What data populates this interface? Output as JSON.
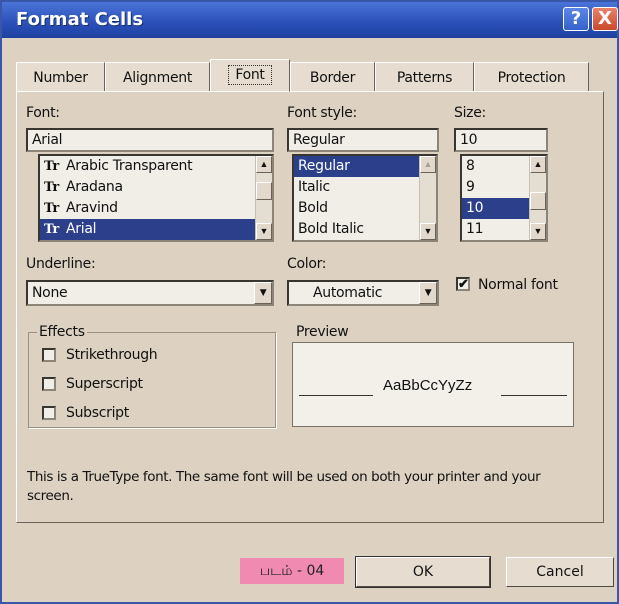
{
  "window": {
    "title": "Format Cells",
    "help_glyph": "?",
    "close_glyph": "X"
  },
  "tabs": [
    {
      "label": "Number"
    },
    {
      "label": "Alignment"
    },
    {
      "label": "Font",
      "active": true
    },
    {
      "label": "Border"
    },
    {
      "label": "Patterns"
    },
    {
      "label": "Protection"
    }
  ],
  "font": {
    "label": "Font:",
    "value": "Arial",
    "items": [
      "Arabic Transparent",
      "Aradana",
      "Aravind",
      "Arial"
    ],
    "selected": "Arial",
    "icon_glyph": "Tr"
  },
  "font_style": {
    "label": "Font style:",
    "value": "Regular",
    "items": [
      "Regular",
      "Italic",
      "Bold",
      "Bold Italic"
    ],
    "selected": "Regular"
  },
  "size": {
    "label": "Size:",
    "value": "10",
    "items": [
      "8",
      "9",
      "10",
      "11"
    ],
    "selected": "10"
  },
  "underline": {
    "label": "Underline:",
    "value": "None"
  },
  "color": {
    "label": "Color:",
    "value": "Automatic"
  },
  "normal_font": {
    "label": "Normal font",
    "checked": true
  },
  "effects": {
    "title": "Effects",
    "strikethrough": {
      "label": "Strikethrough",
      "checked": false
    },
    "superscript": {
      "label": "Superscript",
      "checked": false
    },
    "subscript": {
      "label": "Subscript",
      "checked": false
    }
  },
  "preview": {
    "title": "Preview",
    "sample": "AaBbCcYyZz"
  },
  "note": "This is a TrueType font.  The same font will be used on both your printer and your screen.",
  "caption": "படம் - 04",
  "buttons": {
    "ok": "OK",
    "cancel": "Cancel"
  },
  "scroll_glyphs": {
    "up": "▲",
    "down": "▼"
  }
}
